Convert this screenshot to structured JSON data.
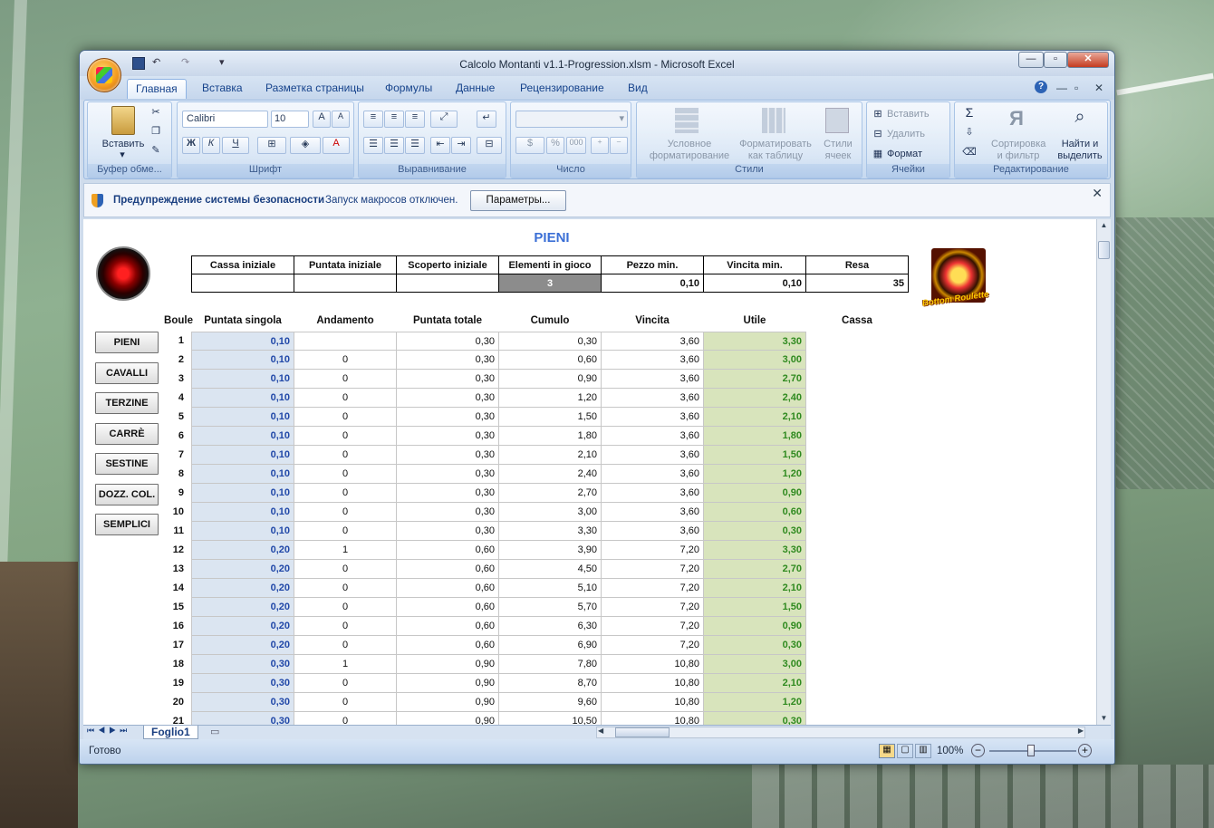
{
  "window": {
    "title": "Calcolo Montanti v1.1-Progression.xlsm - Microsoft Excel"
  },
  "ribbon_tabs": [
    "Главная",
    "Вставка",
    "Разметка страницы",
    "Формулы",
    "Данные",
    "Рецензирование",
    "Вид"
  ],
  "ribbon": {
    "clipboard": {
      "paste": "Вставить",
      "label": "Буфер обме..."
    },
    "font": {
      "name": "Calibri",
      "size": "10",
      "bold": "Ж",
      "italic": "К",
      "underline": "Ч",
      "color": "A",
      "label": "Шрифт"
    },
    "alignment": {
      "label": "Выравнивание"
    },
    "number": {
      "label": "Число",
      "percent": "%",
      "thousands": "000"
    },
    "styles": {
      "cond1": "Условное",
      "cond2": "форматирование",
      "fmt1": "Форматировать",
      "fmt2": "как таблицу",
      "cell1": "Стили",
      "cell2": "ячеек",
      "label": "Стили"
    },
    "cells": {
      "insert": "Вставить",
      "delete": "Удалить",
      "format": "Формат",
      "label": "Ячейки"
    },
    "editing": {
      "sort1": "Сортировка",
      "sort2": "и фильтр",
      "find1": "Найти и",
      "find2": "выделить",
      "label": "Редактирование"
    }
  },
  "security": {
    "title": "Предупреждение системы безопасности",
    "message": "Запуск макросов отключен.",
    "button": "Параметры..."
  },
  "sheet": {
    "title": "PIENI",
    "summary_headers": [
      "Cassa iniziale",
      "Puntata iniziale",
      "Scoperto iniziale",
      "Elementi in gioco",
      "Pezzo min.",
      "Vincita min.",
      "Resa"
    ],
    "summary_values": [
      "",
      "",
      "",
      "3",
      "0,10",
      "0,10",
      "35"
    ],
    "logo_text": "Bottom Roulette",
    "buttons": [
      "PIENI",
      "CAVALLI",
      "TERZINE",
      "CARRÈ",
      "SESTINE",
      "DOZZ. COL.",
      "SEMPLICI"
    ],
    "columns": [
      "Boule",
      "Puntata singola",
      "Andamento",
      "Puntata totale",
      "Cumulo",
      "Vincita",
      "Utile",
      "Cassa"
    ],
    "rows": [
      [
        "1",
        "0,10",
        "",
        "0,30",
        "0,30",
        "3,60",
        "3,30"
      ],
      [
        "2",
        "0,10",
        "0",
        "0,30",
        "0,60",
        "3,60",
        "3,00"
      ],
      [
        "3",
        "0,10",
        "0",
        "0,30",
        "0,90",
        "3,60",
        "2,70"
      ],
      [
        "4",
        "0,10",
        "0",
        "0,30",
        "1,20",
        "3,60",
        "2,40"
      ],
      [
        "5",
        "0,10",
        "0",
        "0,30",
        "1,50",
        "3,60",
        "2,10"
      ],
      [
        "6",
        "0,10",
        "0",
        "0,30",
        "1,80",
        "3,60",
        "1,80"
      ],
      [
        "7",
        "0,10",
        "0",
        "0,30",
        "2,10",
        "3,60",
        "1,50"
      ],
      [
        "8",
        "0,10",
        "0",
        "0,30",
        "2,40",
        "3,60",
        "1,20"
      ],
      [
        "9",
        "0,10",
        "0",
        "0,30",
        "2,70",
        "3,60",
        "0,90"
      ],
      [
        "10",
        "0,10",
        "0",
        "0,30",
        "3,00",
        "3,60",
        "0,60"
      ],
      [
        "11",
        "0,10",
        "0",
        "0,30",
        "3,30",
        "3,60",
        "0,30"
      ],
      [
        "12",
        "0,20",
        "1",
        "0,60",
        "3,90",
        "7,20",
        "3,30"
      ],
      [
        "13",
        "0,20",
        "0",
        "0,60",
        "4,50",
        "7,20",
        "2,70"
      ],
      [
        "14",
        "0,20",
        "0",
        "0,60",
        "5,10",
        "7,20",
        "2,10"
      ],
      [
        "15",
        "0,20",
        "0",
        "0,60",
        "5,70",
        "7,20",
        "1,50"
      ],
      [
        "16",
        "0,20",
        "0",
        "0,60",
        "6,30",
        "7,20",
        "0,90"
      ],
      [
        "17",
        "0,20",
        "0",
        "0,60",
        "6,90",
        "7,20",
        "0,30"
      ],
      [
        "18",
        "0,30",
        "1",
        "0,90",
        "7,80",
        "10,80",
        "3,00"
      ],
      [
        "19",
        "0,30",
        "0",
        "0,90",
        "8,70",
        "10,80",
        "2,10"
      ],
      [
        "20",
        "0,30",
        "0",
        "0,90",
        "9,60",
        "10,80",
        "1,20"
      ],
      [
        "21",
        "0,30",
        "0",
        "0,90",
        "10,50",
        "10,80",
        "0,30"
      ]
    ]
  },
  "sheet_tabs": [
    "Foglio1"
  ],
  "status": {
    "text": "Готово",
    "zoom": "100%"
  },
  "colors": {
    "blue_text": "#2148a8",
    "green_text": "#2f8a1f",
    "blue_fill": "#dbe5f1",
    "green_fill": "#d8e4bc",
    "title": "#3b6fd6"
  }
}
